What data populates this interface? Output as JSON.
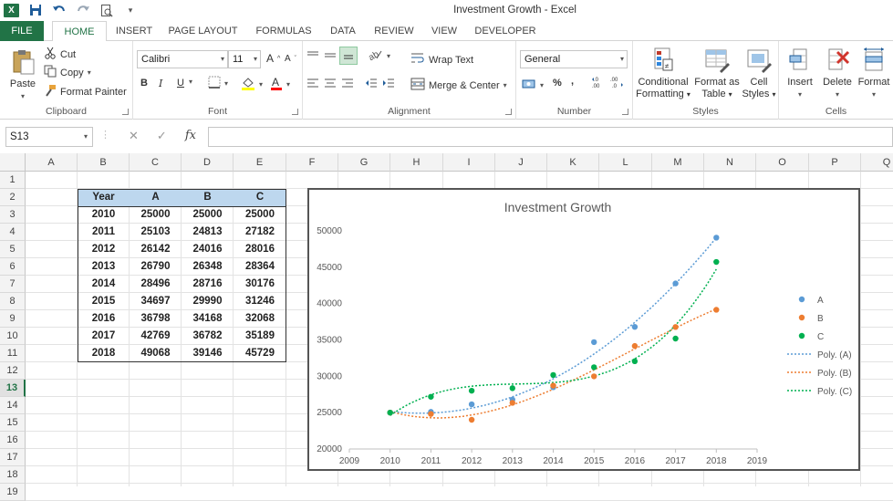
{
  "window": {
    "title": "Investment Growth - Excel"
  },
  "tabs": [
    "FILE",
    "HOME",
    "INSERT",
    "PAGE LAYOUT",
    "FORMULAS",
    "DATA",
    "REVIEW",
    "VIEW",
    "DEVELOPER"
  ],
  "ribbon": {
    "clipboard": {
      "label": "Clipboard",
      "paste": "Paste",
      "cut": "Cut",
      "copy": "Copy",
      "format_painter": "Format Painter"
    },
    "font": {
      "label": "Font",
      "name": "Calibri",
      "size": "11",
      "bold": "B",
      "italic": "I",
      "underline": "U"
    },
    "alignment": {
      "label": "Alignment",
      "wrap_text": "Wrap Text",
      "merge_center": "Merge & Center"
    },
    "number": {
      "label": "Number",
      "format": "General",
      "percent": "%",
      "comma": ","
    },
    "styles": {
      "label": "Styles",
      "conditional_1": "Conditional",
      "conditional_2": "Formatting",
      "format_as_1": "Format as",
      "format_as_2": "Table",
      "cell_1": "Cell",
      "cell_2": "Styles"
    },
    "cells": {
      "label": "Cells",
      "insert": "Insert",
      "delete": "Delete",
      "format": "Format"
    }
  },
  "formula_bar": {
    "name_box": "S13",
    "fx": "fx",
    "content": ""
  },
  "grid": {
    "columns": [
      "A",
      "B",
      "C",
      "D",
      "E",
      "F",
      "G",
      "H",
      "I",
      "J",
      "K",
      "L",
      "M",
      "N",
      "O",
      "P",
      "Q"
    ],
    "rows": [
      "1",
      "2",
      "3",
      "4",
      "5",
      "6",
      "7",
      "8",
      "9",
      "10",
      "11",
      "12",
      "13",
      "14",
      "15",
      "16",
      "17",
      "18",
      "19"
    ],
    "selected_row": "13"
  },
  "table": {
    "headers": [
      "Year",
      "A",
      "B",
      "C"
    ],
    "rows": [
      [
        "2010",
        "25000",
        "25000",
        "25000"
      ],
      [
        "2011",
        "25103",
        "24813",
        "27182"
      ],
      [
        "2012",
        "26142",
        "24016",
        "28016"
      ],
      [
        "2013",
        "26790",
        "26348",
        "28364"
      ],
      [
        "2014",
        "28496",
        "28716",
        "30176"
      ],
      [
        "2015",
        "34697",
        "29990",
        "31246"
      ],
      [
        "2016",
        "36798",
        "34168",
        "32068"
      ],
      [
        "2017",
        "42769",
        "36782",
        "35189"
      ],
      [
        "2018",
        "49068",
        "39146",
        "45729"
      ]
    ]
  },
  "chart_data": {
    "type": "scatter",
    "title": "Investment Growth",
    "xlabel": "",
    "ylabel": "",
    "xlim": [
      2009,
      2019
    ],
    "ylim": [
      20000,
      50000
    ],
    "xticks": [
      "2009",
      "2010",
      "2011",
      "2012",
      "2013",
      "2014",
      "2015",
      "2016",
      "2017",
      "2018",
      "2019"
    ],
    "yticks": [
      "20000",
      "25000",
      "30000",
      "35000",
      "40000",
      "45000",
      "50000"
    ],
    "x": [
      2010,
      2011,
      2012,
      2013,
      2014,
      2015,
      2016,
      2017,
      2018
    ],
    "series": [
      {
        "name": "A",
        "color": "#5b9bd5",
        "values": [
          25000,
          25103,
          26142,
          26790,
          28496,
          34697,
          36798,
          42769,
          49068
        ]
      },
      {
        "name": "B",
        "color": "#ed7d31",
        "values": [
          25000,
          24813,
          24016,
          26348,
          28716,
          29990,
          34168,
          36782,
          39146
        ]
      },
      {
        "name": "C",
        "color": "#00b050",
        "values": [
          25000,
          27182,
          28016,
          28364,
          30176,
          31246,
          32068,
          35189,
          45729
        ]
      }
    ],
    "trendlines": [
      {
        "name": "Poly. (A)",
        "color": "#5b9bd5"
      },
      {
        "name": "Poly. (B)",
        "color": "#ed7d31"
      },
      {
        "name": "Poly. (C)",
        "color": "#00b050"
      }
    ],
    "legend": "right",
    "grid": false
  }
}
